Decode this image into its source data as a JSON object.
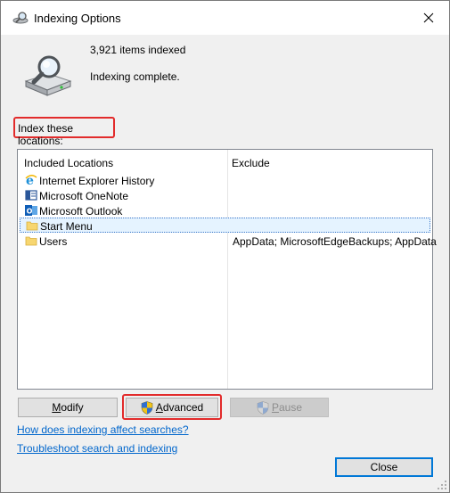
{
  "window": {
    "title": "Indexing Options"
  },
  "status": {
    "items_indexed": "3,921 items indexed",
    "state": "Indexing complete."
  },
  "locations": {
    "label": "Index these locations:",
    "columns": {
      "included": "Included Locations",
      "exclude": "Exclude"
    },
    "rows": [
      {
        "name": "Internet Explorer History",
        "exclude": "",
        "icon": "ie-icon"
      },
      {
        "name": "Microsoft OneNote",
        "exclude": "",
        "icon": "onenote-icon"
      },
      {
        "name": "Microsoft Outlook",
        "exclude": "",
        "icon": "outlook-icon"
      },
      {
        "name": "Start Menu",
        "exclude": "",
        "icon": "folder-icon",
        "selected": true
      },
      {
        "name": "Users",
        "exclude": "AppData; MicrosoftEdgeBackups; AppData",
        "icon": "folder-icon"
      }
    ]
  },
  "buttons": {
    "modify": "Modify",
    "advanced": "Advanced",
    "pause": "Pause",
    "close": "Close"
  },
  "links": {
    "how_affects": "How does indexing affect searches?",
    "troubleshoot": "Troubleshoot search and indexing"
  },
  "colors": {
    "highlight": "#e22b2b",
    "link": "#0066cc",
    "selection": "#e5f3ff",
    "focus": "#0078d7"
  }
}
